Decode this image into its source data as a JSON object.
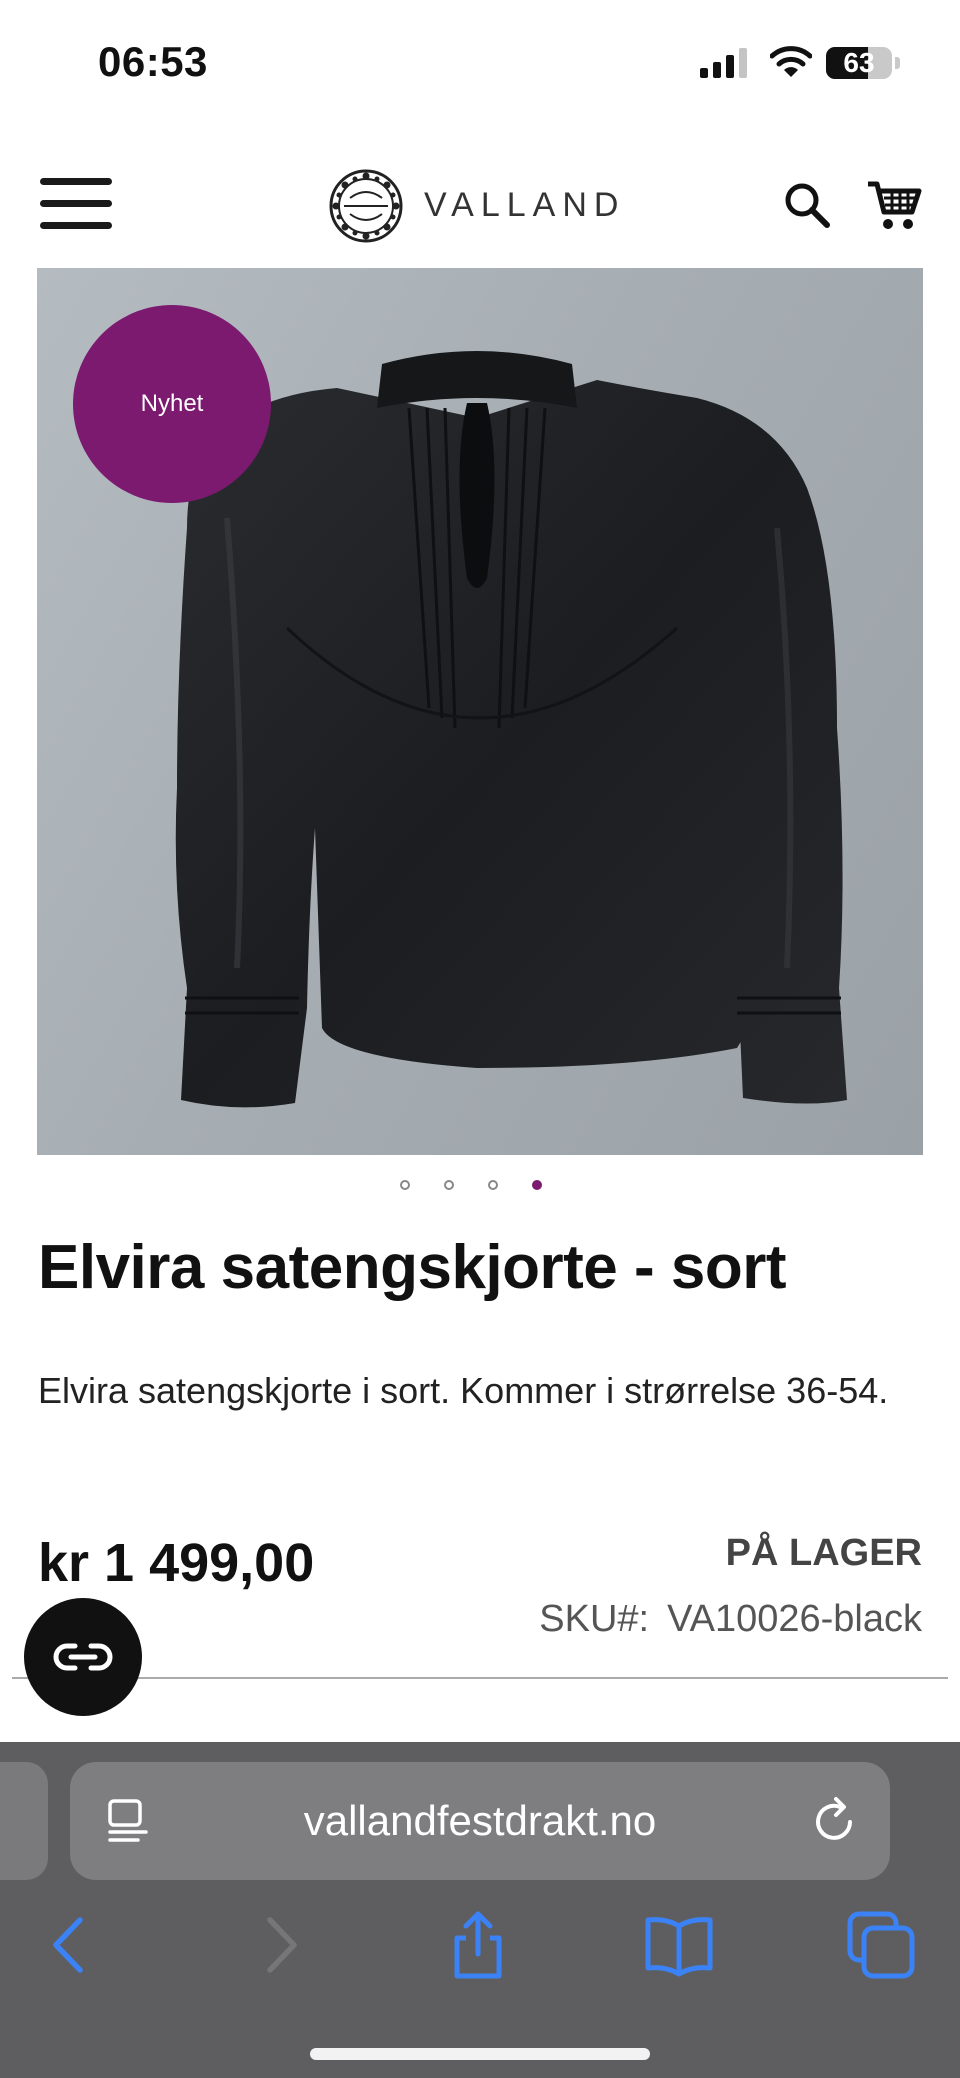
{
  "status_bar": {
    "time": "06:53",
    "battery_percent": "63",
    "battery_level": 0.63,
    "icons": [
      "signal-icon",
      "wifi-icon",
      "battery-icon"
    ]
  },
  "header": {
    "brand": "VALLAND",
    "icons": [
      "menu-icon",
      "logo-emblem-icon",
      "search-icon",
      "cart-icon"
    ]
  },
  "product": {
    "badge": "Nyhet",
    "image_count": 4,
    "active_image_index": 3,
    "title": "Elvira satengskjorte - sort",
    "description": "Elvira satengskjorte i sort. Kommer i strørrelse 36-54.",
    "price": "kr 1 499,00",
    "stock_status": "PÅ LAGER",
    "sku_label": "SKU#:",
    "sku_value": "VA10026-black"
  },
  "chat": {
    "icon": "chat-icon"
  },
  "browser": {
    "url": "vallandfestdrakt.no",
    "icons": [
      "reader-mode-icon",
      "reload-icon",
      "back-icon",
      "forward-icon",
      "share-icon",
      "bookmarks-icon",
      "tabs-icon"
    ]
  },
  "colors": {
    "accent": "#7b1a6f",
    "ios_blue": "#3b82f6",
    "chrome_bg": "#5e5e60"
  }
}
